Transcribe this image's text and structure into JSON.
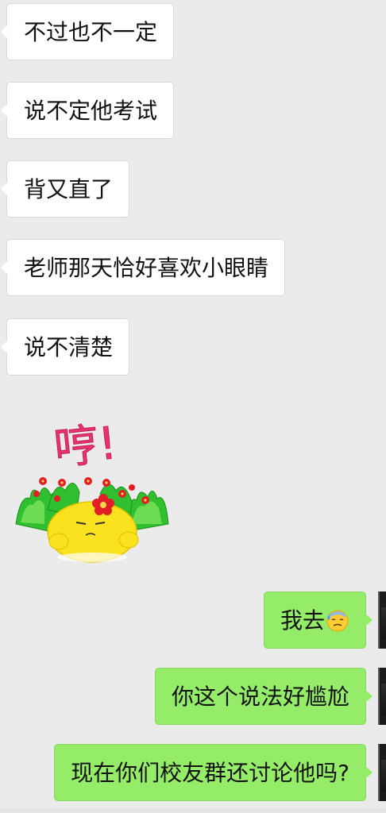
{
  "incoming_messages": [
    {
      "text": "不过也不一定"
    },
    {
      "text": "说不定他考试"
    },
    {
      "text": "背又直了"
    },
    {
      "text": "老师那天恰好喜欢小眼睛"
    },
    {
      "text": "说不清楚"
    }
  ],
  "sticker": {
    "text": "哼!",
    "icon": "angry-chick-sticker"
  },
  "outgoing_messages": [
    {
      "text": "我去",
      "emoji": "sweat-smile-emoji"
    },
    {
      "text": "你这个说法好尴尬"
    },
    {
      "text": "现在你们校友群还讨论他吗?"
    }
  ],
  "colors": {
    "background": "#ebebeb",
    "incoming_bubble": "#ffffff",
    "outgoing_bubble": "#95ec69"
  }
}
